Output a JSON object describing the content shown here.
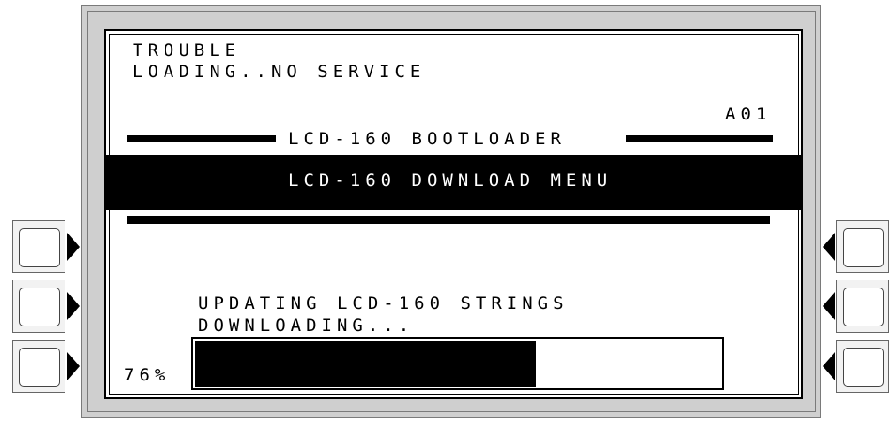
{
  "status": {
    "line1": "TROUBLE",
    "line2": "LOADING..NO SERVICE"
  },
  "screen_code": "A01",
  "header": {
    "title": "LCD-160 BOOTLOADER"
  },
  "menu": {
    "title": "LCD-160 DOWNLOAD MENU"
  },
  "messages": {
    "line1": "UPDATING LCD-160 STRINGS",
    "line2": "DOWNLOADING..."
  },
  "progress": {
    "percent_label": "76%",
    "value": 0.65
  },
  "soft_keys": {
    "left": [
      "left-key-1",
      "left-key-2",
      "left-key-3"
    ],
    "right": [
      "right-key-1",
      "right-key-2",
      "right-key-3"
    ]
  },
  "colors": {
    "screen_bg": "#ffffff",
    "text": "#000000",
    "bezel": "#cfcfcf"
  }
}
